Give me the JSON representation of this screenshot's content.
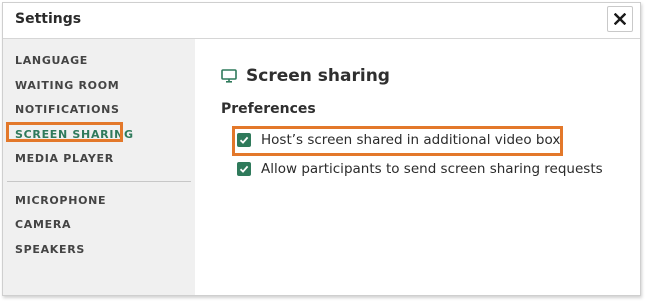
{
  "dialog": {
    "title": "Settings",
    "close_icon": "close-icon"
  },
  "sidebar": {
    "items": [
      {
        "label": "LANGUAGE"
      },
      {
        "label": "WAITING ROOM"
      },
      {
        "label": "NOTIFICATIONS"
      },
      {
        "label": "SCREEN SHARING",
        "active": true
      },
      {
        "label": "MEDIA PLAYER"
      },
      {
        "label": "MICROPHONE"
      },
      {
        "label": "CAMERA"
      },
      {
        "label": "SPEAKERS"
      }
    ]
  },
  "content": {
    "section_icon": "monitor-icon",
    "section_title": "Screen sharing",
    "preferences_heading": "Preferences",
    "options": [
      {
        "label": "Host’s screen shared in additional video box",
        "checked": true
      },
      {
        "label": "Allow participants to send screen sharing requests",
        "checked": true
      }
    ]
  },
  "colors": {
    "accent_green": "#2f7a5b",
    "highlight_orange": "#e3782a",
    "sidebar_bg": "#f0f0f0"
  }
}
